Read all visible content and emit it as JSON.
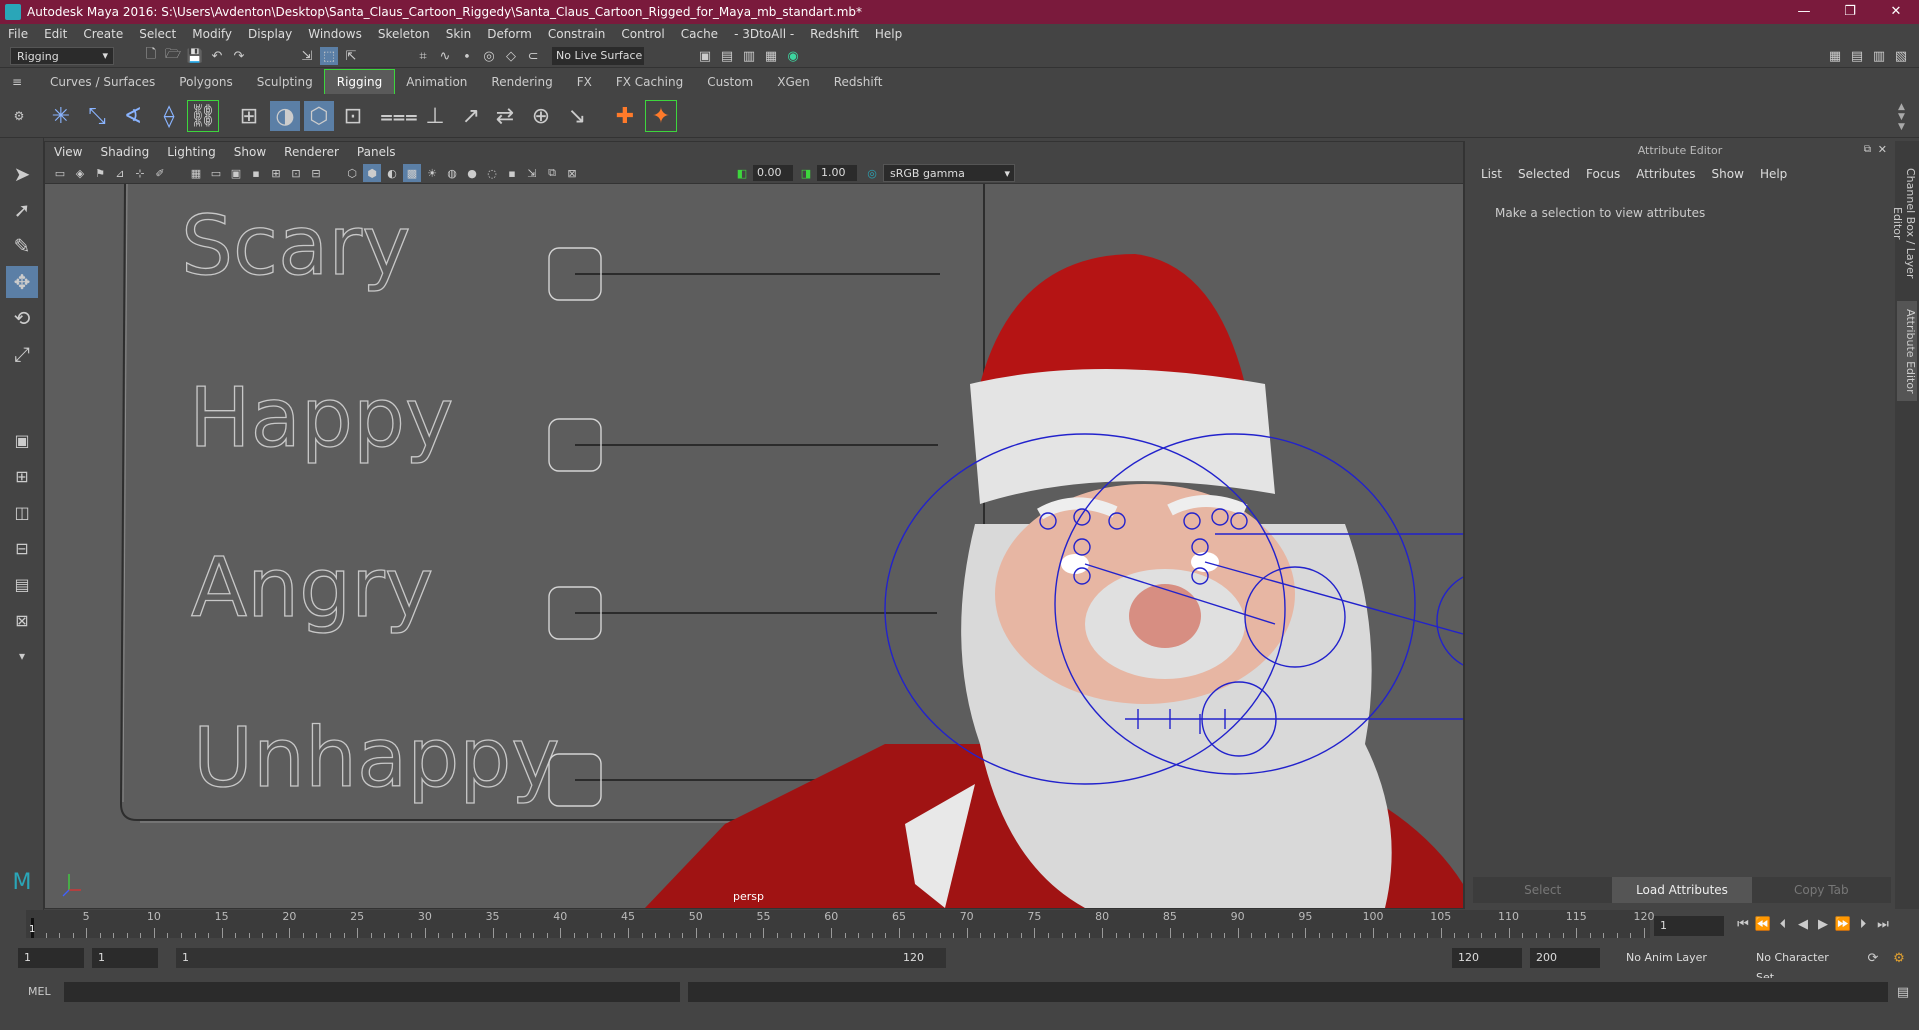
{
  "window": {
    "title": "Autodesk Maya 2016: S:\\Users\\Avdenton\\Desktop\\Santa_Claus_Cartoon_Riggedy\\Santa_Claus_Cartoon_Rigged_for_Maya_mb_standart.mb*",
    "controls": [
      "—",
      "❐",
      "✕"
    ]
  },
  "menubar": [
    "File",
    "Edit",
    "Create",
    "Select",
    "Modify",
    "Display",
    "Windows",
    "Skeleton",
    "Skin",
    "Deform",
    "Constrain",
    "Control",
    "Cache",
    "- 3DtoAll -",
    "Redshift",
    "Help"
  ],
  "statusline": {
    "menuset": "Rigging",
    "live_surface": "No Live Surface"
  },
  "shelf": {
    "tabs": [
      "Curves / Surfaces",
      "Polygons",
      "Sculpting",
      "Rigging",
      "Animation",
      "Rendering",
      "FX",
      "FX Caching",
      "Custom",
      "XGen",
      "Redshift"
    ],
    "active_tab": "Rigging"
  },
  "viewport": {
    "menus": [
      "View",
      "Shading",
      "Lighting",
      "Show",
      "Renderer",
      "Panels"
    ],
    "exposure": "0.00",
    "gamma": "1.00",
    "color_space": "sRGB gamma",
    "camera": "persp",
    "sliders": [
      {
        "label": "Scary",
        "value": 0.0
      },
      {
        "label": "Happy",
        "value": 0.0
      },
      {
        "label": "Angry",
        "value": 0.0
      },
      {
        "label": "Unhappy",
        "value": 0.0
      }
    ]
  },
  "attribute_editor": {
    "header": "Attribute Editor",
    "menus": [
      "List",
      "Selected",
      "Focus",
      "Attributes",
      "Show",
      "Help"
    ],
    "message": "Make a selection to view attributes",
    "buttons": [
      "Select",
      "Load Attributes",
      "Copy Tab"
    ],
    "side_tabs": [
      "Channel Box / Layer Editor",
      "Attribute Editor"
    ]
  },
  "timeline": {
    "labels": [
      "5",
      "10",
      "15",
      "20",
      "25",
      "30",
      "35",
      "40",
      "45",
      "50",
      "55",
      "60",
      "65",
      "70",
      "75",
      "80",
      "85",
      "90",
      "95",
      "100",
      "105",
      "110",
      "115",
      "120"
    ],
    "current_frame": "1",
    "current_frame_marker": "1"
  },
  "range": {
    "start": "1",
    "playback_start": "1",
    "slider_start": "1",
    "slider_end": "120",
    "playback_end": "120",
    "end": "200",
    "anim_layer": "No Anim Layer",
    "character_set": "No Character Set"
  },
  "cmdline": {
    "label": "MEL"
  }
}
